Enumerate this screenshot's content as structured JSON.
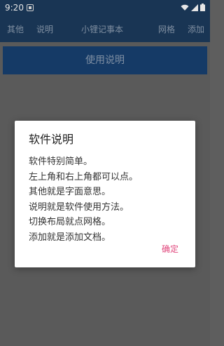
{
  "status_bar": {
    "time": "9:20"
  },
  "toolbar": {
    "other_label": "其他",
    "help_label": "说明",
    "title": "小锂记事本",
    "grid_label": "网格",
    "add_label": "添加"
  },
  "main": {
    "help_button_label": "使用说明"
  },
  "dialog": {
    "title": "软件说明",
    "lines": [
      "软件特别简单。",
      "左上角和右上角都可以点。",
      "其他就是字面意思。",
      "说明就是软件使用方法。",
      "切换布局就点网格。",
      "添加就是添加文档。"
    ],
    "ok_label": "确定"
  },
  "colors": {
    "toolbar_bg": "#193554",
    "button_bg": "#153a66",
    "scrim": "#5a5a5a",
    "accent": "#e0457b"
  }
}
